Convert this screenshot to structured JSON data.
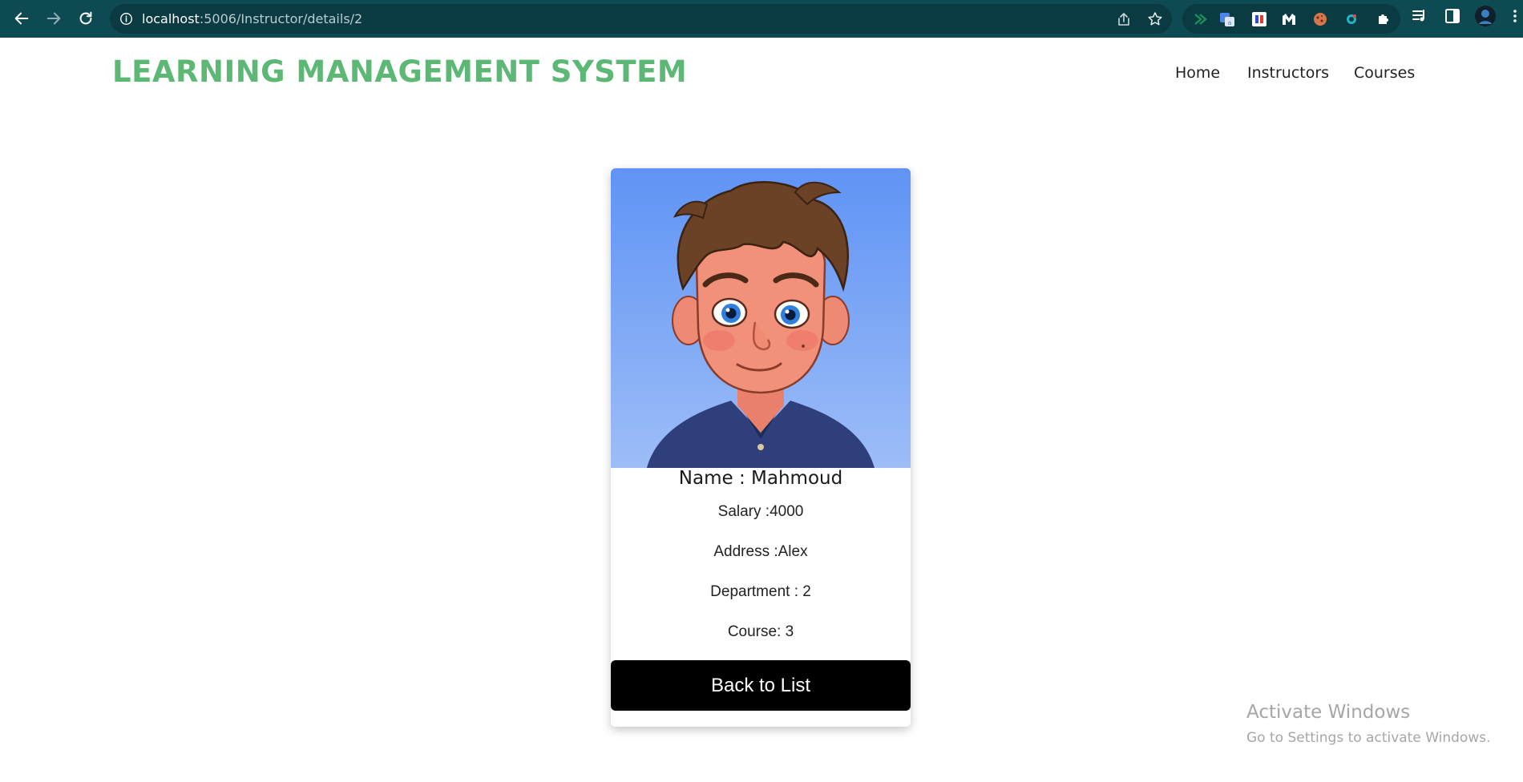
{
  "browser": {
    "url_host": "localhost",
    "url_path": ":5006/Instructor/details/2"
  },
  "site": {
    "title": "LEARNING MANAGEMENT SYSTEM",
    "nav": [
      {
        "label": "Home"
      },
      {
        "label": "Instructors"
      },
      {
        "label": "Courses"
      }
    ]
  },
  "instructor": {
    "name": "Name : Mahmoud",
    "salary": "Salary :4000",
    "address": "Address :Alex",
    "department": "Department : 2",
    "course": "Course: 3",
    "avatar_icon": "cartoon-boy-avatar"
  },
  "actions": {
    "back_label": "Back to List"
  },
  "watermark": {
    "title": "Activate Windows",
    "subtitle": "Go to Settings to activate Windows."
  },
  "colors": {
    "chrome_bar": "#0e4a52",
    "brand_green": "#5cb874",
    "button_bg": "#000000"
  }
}
